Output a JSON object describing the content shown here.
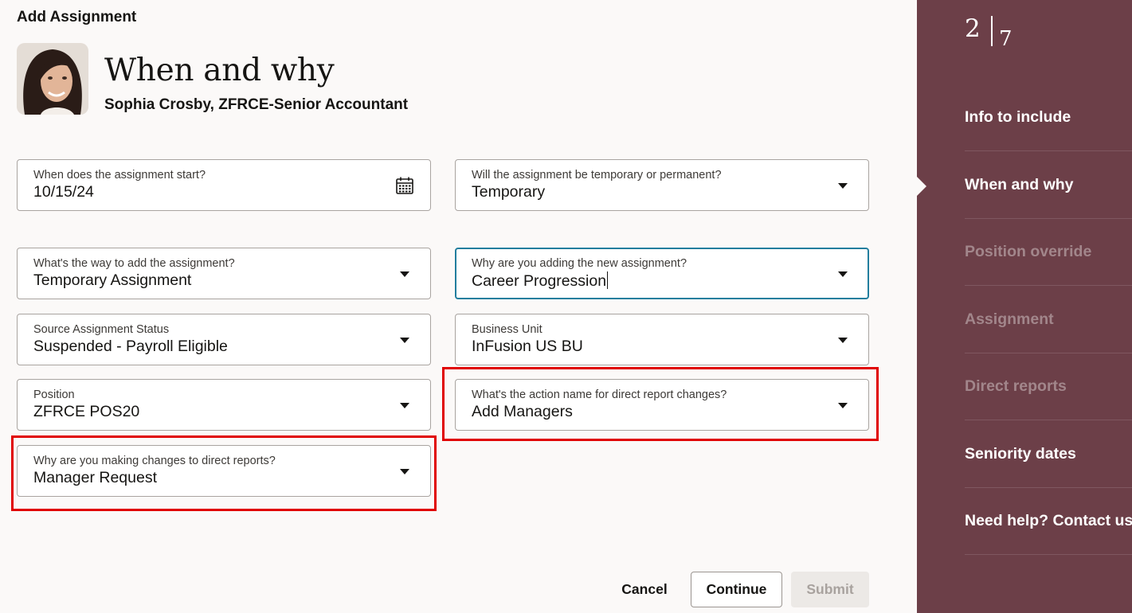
{
  "header": {
    "page_title": "Add Assignment",
    "section_title": "When and why",
    "person": "Sophia Crosby, ZFRCE-Senior Accountant"
  },
  "fields": {
    "start_date": {
      "label": "When does the assignment start?",
      "value": "10/15/24",
      "icon": "calendar-icon"
    },
    "temp_perm": {
      "label": "Will the assignment be temporary or permanent?",
      "value": "Temporary"
    },
    "add_way": {
      "label": "What's the way to add the assignment?",
      "value": "Temporary Assignment"
    },
    "reason": {
      "label": "Why are you adding the new assignment?",
      "value": "Career Progression"
    },
    "source_status": {
      "label": "Source Assignment Status",
      "value": "Suspended - Payroll Eligible"
    },
    "business_unit": {
      "label": "Business Unit",
      "value": "InFusion US BU"
    },
    "position": {
      "label": "Position",
      "value": "ZFRCE POS20"
    },
    "action_name": {
      "label": "What's the action name for direct report changes?",
      "value": "Add Managers"
    },
    "direct_reason": {
      "label": "Why are you making changes to direct reports?",
      "value": "Manager Request"
    }
  },
  "footer": {
    "cancel": "Cancel",
    "continue": "Continue",
    "submit": "Submit"
  },
  "sidebar": {
    "current_step": "2",
    "total_steps": "7",
    "items": [
      {
        "label": "Info to include",
        "state": "enabled"
      },
      {
        "label": "When and why",
        "state": "current"
      },
      {
        "label": "Position override",
        "state": "disabled"
      },
      {
        "label": "Assignment",
        "state": "disabled"
      },
      {
        "label": "Direct reports",
        "state": "disabled"
      },
      {
        "label": "Seniority dates",
        "state": "enabled"
      },
      {
        "label": "Need help? Contact us.",
        "state": "enabled"
      }
    ]
  },
  "colors": {
    "sidebar_bg": "#6c3f48",
    "focus_border": "#227e9e",
    "highlight_red": "#e00000"
  }
}
